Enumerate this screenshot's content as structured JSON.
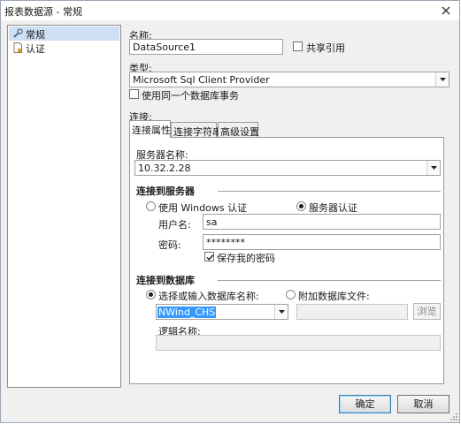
{
  "window": {
    "title": "报表数据源 - 常规"
  },
  "nav": {
    "items": [
      {
        "label": "常规",
        "icon": "wrench-icon",
        "selected": true
      },
      {
        "label": "认证",
        "icon": "document-icon",
        "selected": false
      }
    ]
  },
  "form": {
    "name_label": "名称:",
    "name_value": "DataSource1",
    "shared_ref_label": "共享引用",
    "shared_ref_checked": false,
    "type_label": "类型:",
    "type_value": "Microsoft Sql Client Provider",
    "single_txn_label": "使用同一个数据库事务",
    "single_txn_checked": false,
    "connection_label": "连接:"
  },
  "tabs": [
    {
      "label": "连接属性",
      "active": true
    },
    {
      "label": "连接字符串",
      "active": false
    },
    {
      "label": "高级设置",
      "active": false
    }
  ],
  "connection": {
    "server_name_label": "服务器名称:",
    "server_name_value": "10.32.2.28",
    "connect_server_heading": "连接到服务器",
    "auth_windows_label": "使用 Windows 认证",
    "auth_windows_selected": false,
    "auth_server_label": "服务器认证",
    "auth_server_selected": true,
    "username_label": "用户名:",
    "username_value": "sa",
    "password_label": "密码:",
    "password_value": "********",
    "save_password_label": "保存我的密码",
    "save_password_checked": true,
    "connect_db_heading": "连接到数据库",
    "select_db_label": "选择或输入数据库名称:",
    "select_db_selected": true,
    "select_db_value": "NWind_CHS",
    "attach_db_label": "附加数据库文件:",
    "attach_db_selected": false,
    "attach_db_value": "",
    "browse_label": "浏览",
    "logical_name_label": "逻辑名称:",
    "logical_name_value": ""
  },
  "buttons": {
    "ok": "确定",
    "cancel": "取消"
  },
  "colors": {
    "selection": "#3399ff",
    "nav_selected": "#cfe0f5",
    "dialog_bg": "#f0f0f0"
  }
}
